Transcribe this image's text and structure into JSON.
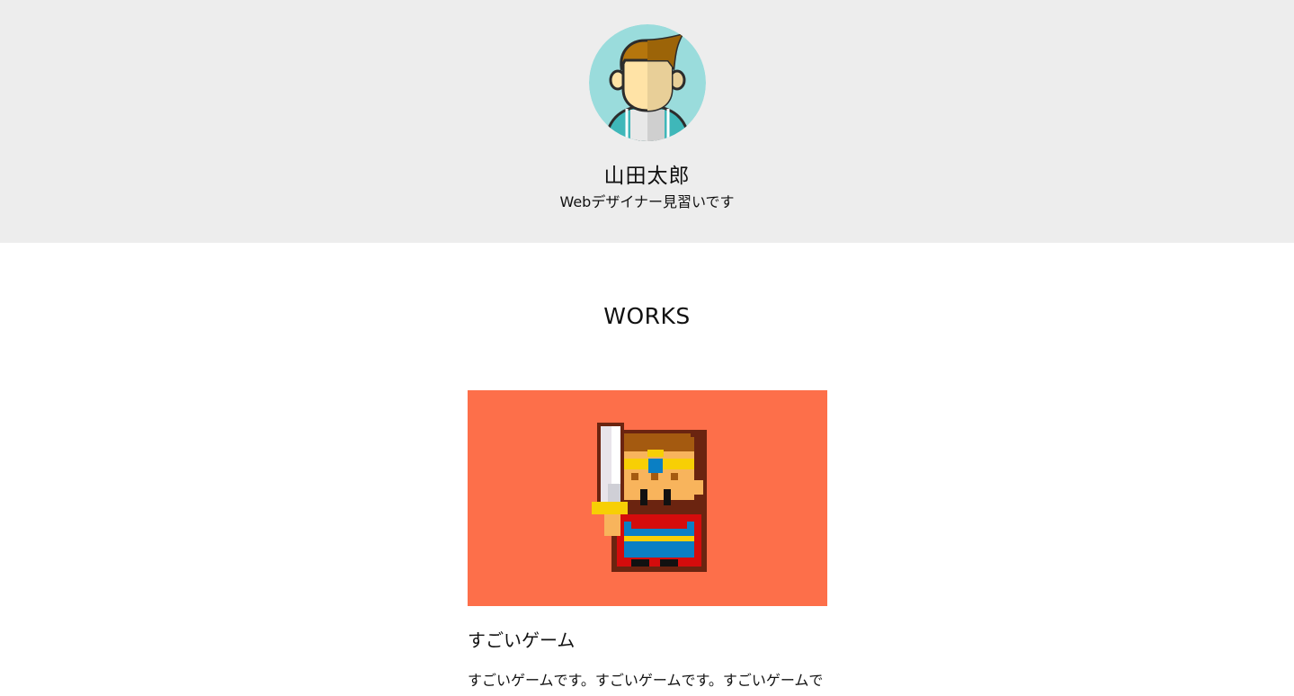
{
  "profile": {
    "name": "山田太郎",
    "tagline": "Webデザイナー見習いです",
    "avatar_icon": "person-avatar-icon"
  },
  "works": {
    "heading": "WORKS",
    "items": [
      {
        "thumbnail_icon": "pixel-hero-swordsman-icon",
        "thumbnail_bg": "#fd6f4a",
        "title": "すごいゲーム",
        "description": "すごいゲームです。すごいゲームです。すごいゲームで"
      }
    ]
  },
  "colors": {
    "header_bg": "#ededed",
    "avatar_bg": "#9adcdc",
    "page_bg": "#ffffff"
  }
}
